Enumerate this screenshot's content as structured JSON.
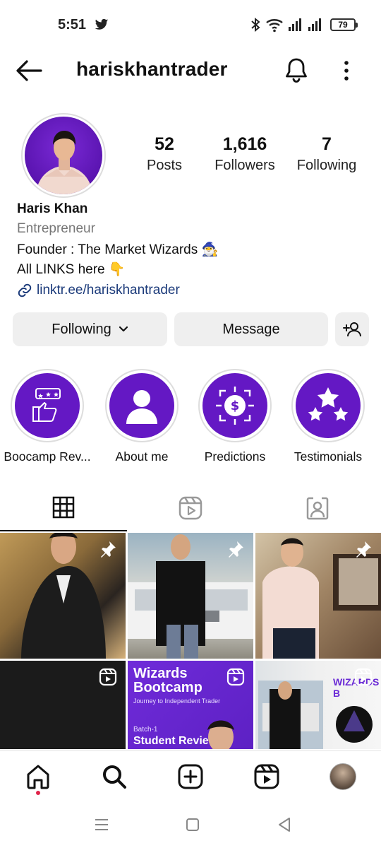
{
  "status_bar": {
    "time": "5:51",
    "battery": "79",
    "icons": [
      "twitter-icon",
      "bluetooth-icon",
      "wifi-icon",
      "signal-icon",
      "signal-icon",
      "battery-icon"
    ]
  },
  "header": {
    "username": "hariskhantrader",
    "icons": [
      "back-arrow-icon",
      "bell-icon",
      "more-vertical-icon"
    ]
  },
  "profile": {
    "stats": [
      {
        "value": "52",
        "label": "Posts"
      },
      {
        "value": "1,616",
        "label": "Followers"
      },
      {
        "value": "7",
        "label": "Following"
      }
    ],
    "name": "Haris Khan",
    "category": "Entrepreneur",
    "bio_line1": "Founder : The Market Wizards 🧙‍♂️",
    "bio_line2": "All LINKS here 👇",
    "link": "linktr.ee/hariskhantrader"
  },
  "actions": {
    "following_label": "Following",
    "message_label": "Message"
  },
  "highlights": [
    {
      "label": "Boocamp Rev...",
      "icon": "thumbs-up-review-icon"
    },
    {
      "label": "About me",
      "icon": "person-icon"
    },
    {
      "label": "Predictions",
      "icon": "dollar-target-icon"
    },
    {
      "label": "Testimonials",
      "icon": "stars-icon"
    }
  ],
  "tabs": [
    {
      "name": "grid",
      "icon": "grid-icon",
      "active": true
    },
    {
      "name": "reels",
      "icon": "reels-icon",
      "active": false
    },
    {
      "name": "tagged",
      "icon": "tagged-user-icon",
      "active": false
    }
  ],
  "grid_posts": [
    {
      "badge": "pin-icon"
    },
    {
      "badge": "pin-icon"
    },
    {
      "badge": "pin-icon"
    },
    {
      "badge": "reel-icon"
    },
    {
      "badge": "reel-icon",
      "title": "Wizards Bootcamp",
      "subtitle": "Journey to Independent Trader",
      "batch": "Batch-1",
      "reviews": "Student Reviews"
    },
    {
      "badge": "reel-icon",
      "overlay_text": "WIZARDS B"
    }
  ],
  "bottom_nav": [
    "home-icon",
    "search-icon",
    "create-icon",
    "reels-icon",
    "profile-avatar"
  ],
  "colors": {
    "accent_purple": "#6418c4",
    "link_blue": "#1b3a7a",
    "notification_dot": "#e0244a"
  }
}
